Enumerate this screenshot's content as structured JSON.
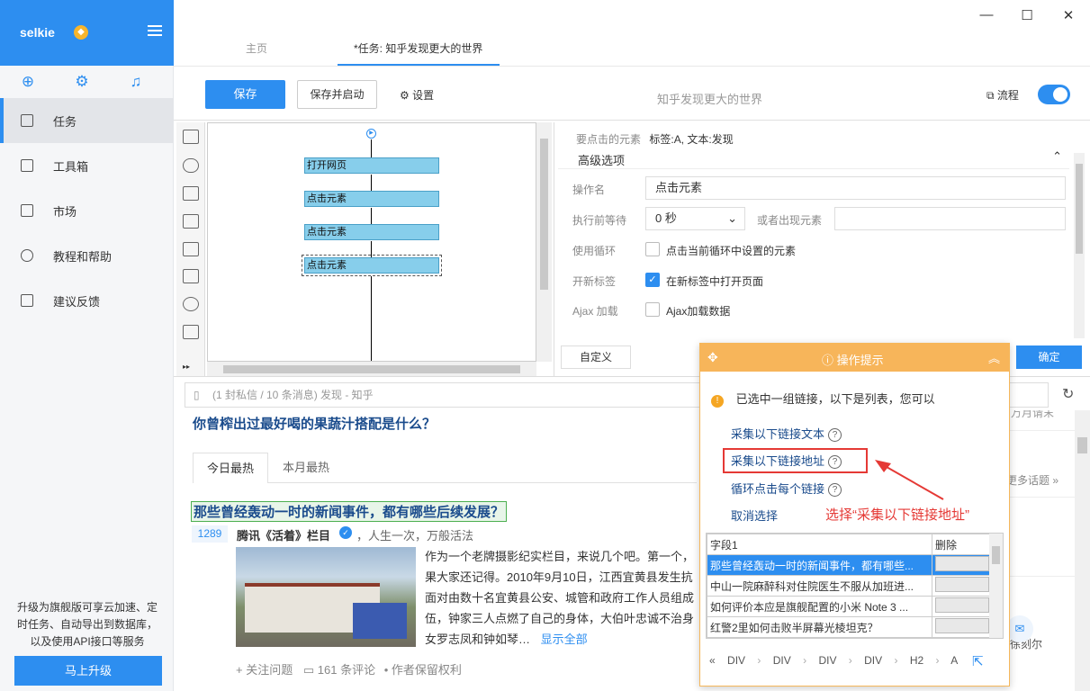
{
  "app": {
    "name": "selkie"
  },
  "sidebar": {
    "items": [
      {
        "label": "任务"
      },
      {
        "label": "工具箱"
      },
      {
        "label": "市场"
      },
      {
        "label": "教程和帮助"
      },
      {
        "label": "建议反馈"
      }
    ],
    "promo": "升级为旗舰版可享云加速、定时任务、自动导出到数据库，以及使用API接口等服务",
    "upgrade_label": "马上升级"
  },
  "tabs": [
    {
      "label": "主页"
    },
    {
      "label": "*任务: 知乎发现更大的世界"
    }
  ],
  "toolbar": {
    "save": "保存",
    "save_start": "保存并启动",
    "settings": "设置",
    "task_title": "知乎发现更大的世界",
    "flow": "流程"
  },
  "flow": {
    "nodes": [
      "打开网页",
      "点击元素",
      "点击元素",
      "点击元素"
    ]
  },
  "props": {
    "target_label": "要点击的元素",
    "target_value": "标签:A, 文本:发现",
    "section": "高级选项",
    "op_name_label": "操作名",
    "op_name_value": "点击元素",
    "wait_label": "执行前等待",
    "wait_value": "0 秒",
    "or_label": "或者出现元素",
    "loop_label": "使用循环",
    "loop_text": "点击当前循环中设置的元素",
    "newtab_label": "开新标签",
    "newtab_text": "在新标签中打开页面",
    "ajax_label": "Ajax 加载",
    "ajax_text": "Ajax加载数据",
    "custom": "自定义",
    "ok": "确定"
  },
  "browser": {
    "url": "(1 封私信 / 10 条消息) 发现 - 知乎",
    "question": "你曾榨出过最好喝的果蔬汁搭配是什么？",
    "tab_today": "今日最热",
    "tab_month": "本月最热",
    "article_title": "那些曾经轰动一时的新闻事件，都有哪些后续发展？",
    "votes": "1289",
    "author": "腾讯《活着》栏目",
    "author_bio": "，人生一次，万般活法",
    "excerpt_lines": [
      "作为一个老牌摄影纪实栏目，来说几个吧。第一个，",
      "果大家还记得。2010年9月10日，江西宜黄县发生抗",
      "面对由数十名宜黄县公安、城管和政府工作人员组成",
      "伍，钟家三人点燃了自己的身体，大伯叶忠诚不治身",
      "女罗志凤和钟如琴…"
    ],
    "show_all": "显示全部",
    "follow": "+ 关注问题",
    "comments": "161 条评论",
    "rights": "• 作者保留权利",
    "right_frag1": "万月请末",
    "right_frag2": "更多话题 »",
    "right_frag3": "徐刻尔"
  },
  "popup": {
    "title": "操作提示",
    "message": "已选中一组链接，以下是列表，您可以",
    "links": [
      "采集以下链接文本",
      "采集以下链接地址",
      "循环点击每个链接",
      "取消选择"
    ],
    "table_headers": [
      "字段1",
      "删除"
    ],
    "rows": [
      "那些曾经轰动一时的新闻事件，都有哪些...",
      "中山一院麻醉科对住院医生不服从加班进...",
      "如何评价本应是旗舰配置的小米 Note 3 ...",
      "红警2里如何击败半屏幕光棱坦克？"
    ],
    "crumbs": [
      "«",
      "DIV",
      "DIV",
      "DIV",
      "DIV",
      "H2",
      "A"
    ]
  },
  "annotation": "选择“采集以下链接地址”",
  "colors": {
    "accent": "#2d8ef0",
    "popup_header": "#f7b55a",
    "highlight": "#e53935"
  }
}
